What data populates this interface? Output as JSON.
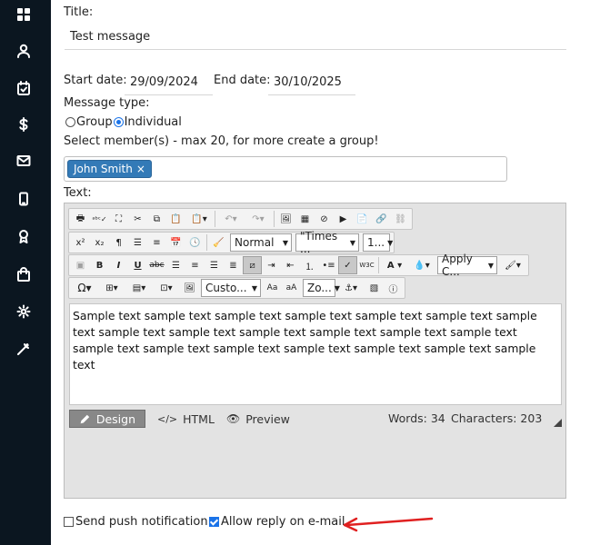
{
  "sidebar": {
    "items": [
      {
        "icon": "dashboard-icon"
      },
      {
        "icon": "user-icon"
      },
      {
        "icon": "calendar-check-icon"
      },
      {
        "icon": "dollar-icon"
      },
      {
        "icon": "mail-icon"
      },
      {
        "icon": "mobile-icon"
      },
      {
        "icon": "award-icon"
      },
      {
        "icon": "shopping-bag-icon"
      },
      {
        "icon": "gear-icon"
      },
      {
        "icon": "magic-wand-icon"
      }
    ],
    "bg_color": "#0b1620"
  },
  "form": {
    "title_label": "Title:",
    "title_value": "Test message",
    "start_date_label": "Start date:",
    "start_date_value": "29/09/2024",
    "end_date_label": "End date:",
    "end_date_value": "30/10/2025",
    "message_type_label": "Message type:",
    "message_type_options": [
      "Group",
      "Individual"
    ],
    "message_type_selected": "Individual",
    "members_label": "Select member(s) - max 20, for more create a group!",
    "members": [
      {
        "name": "John Smith",
        "remove": "×"
      }
    ],
    "text_label": "Text:"
  },
  "editor": {
    "paragraph_format": "Normal",
    "font_name": "\"Times ...",
    "font_size": "1...",
    "custom_style": "Custo...",
    "zoom": "Zo...",
    "apply_css": "Apply C...",
    "content": "Sample text sample text sample text sample text sample text sample text sample text sample text sample text sample text sample text sample text sample text sample text sample text sample text sample text sample text sample text sample text",
    "modes": [
      "Design",
      "HTML",
      "Preview"
    ],
    "active_mode": "Design",
    "word_count": "Words: 34",
    "char_count": "Characters: 203"
  },
  "options": {
    "push_label": "Send push notification",
    "push_checked": false,
    "reply_label": "Allow reply on e-mail",
    "reply_checked": true
  },
  "colors": {
    "accent": "#1a73e8",
    "tag": "#337ab7",
    "arrow": "#e02020"
  }
}
